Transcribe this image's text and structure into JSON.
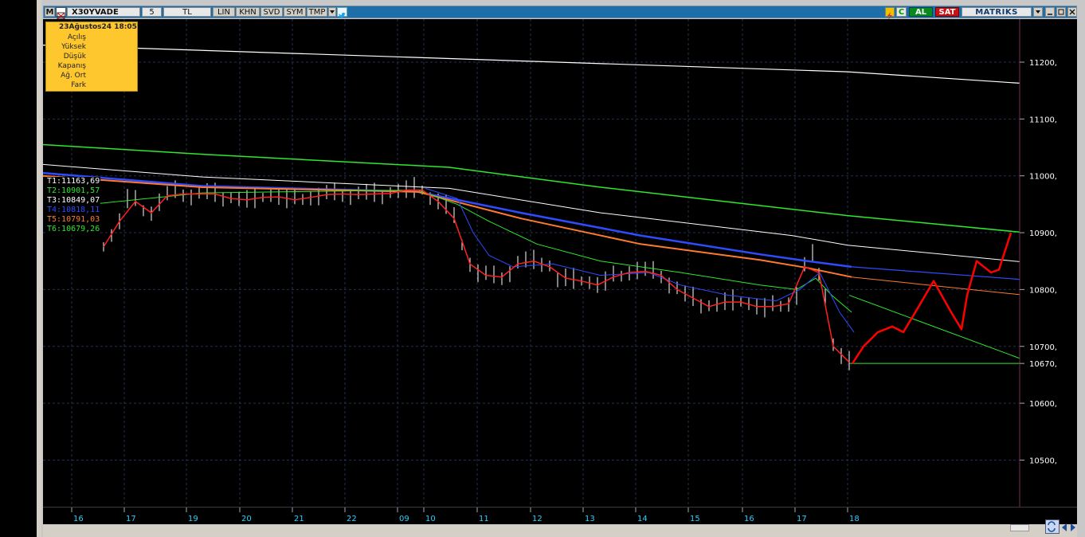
{
  "toolbar": {
    "symbol": "X30YVADE",
    "period": "5",
    "currency": "TL",
    "scale_items": [
      "LIN",
      "KHN",
      "SVD",
      "SYM",
      "TMP"
    ],
    "buy_label": "AL",
    "sell_label": "SAT",
    "brand": "MATRIKS"
  },
  "info_box": {
    "date": "23Ağustos24 18:05",
    "labels": [
      "Açılış",
      "Yüksek",
      "Düşük",
      "Kapanış",
      "Ağ. Ort",
      "Fark"
    ]
  },
  "indicators": [
    {
      "label": "T1:11163,69",
      "color": "#ffffff"
    },
    {
      "label": "T2:10901,57",
      "color": "#2ee82e"
    },
    {
      "label": "T3:10849,07",
      "color": "#ffffff"
    },
    {
      "label": "T4:10818,11",
      "color": "#2f4bff"
    },
    {
      "label": "T5:10791,03",
      "color": "#ff7a2e"
    },
    {
      "label": "T6:10679,26",
      "color": "#2ee82e"
    }
  ],
  "y_axis": {
    "ticks": [
      "11200,",
      "11100,",
      "11000,",
      "10900,",
      "10800,",
      "10700,",
      "10670,",
      "10600,",
      "10500,"
    ]
  },
  "x_axis": {
    "ticks": [
      "16",
      "17",
      "19",
      "20",
      "21",
      "22",
      "09",
      "10",
      "11",
      "12",
      "13",
      "14",
      "15",
      "16",
      "17",
      "18"
    ]
  },
  "colors": {
    "background": "#000000",
    "grid": "#22304f",
    "axis_text": "#ffffff",
    "x_axis_text": "#29d0ff",
    "price_bars": "#ffffff",
    "ma_fast": "#ff2020",
    "ma_blue": "#2f4bff",
    "ma_orange": "#ff7a2e",
    "ma_green": "#2ee82e",
    "ma_white": "#ffffff",
    "drawing": "#ff0000"
  }
}
